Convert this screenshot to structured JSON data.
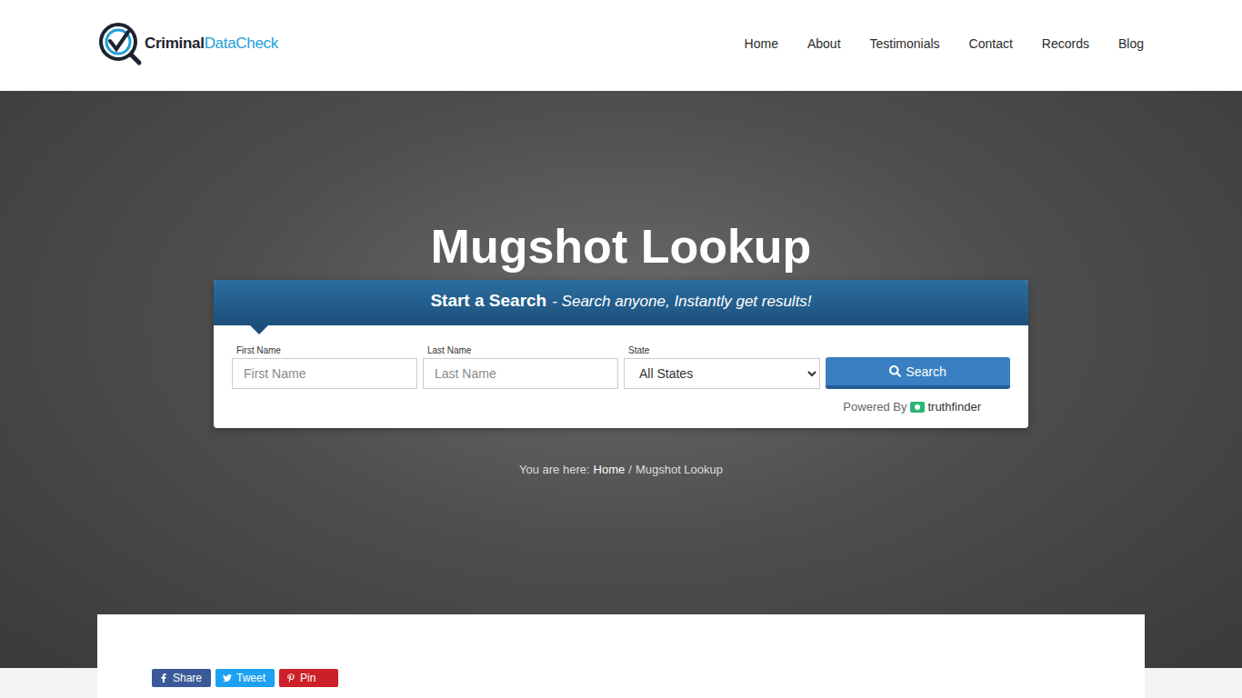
{
  "logo": {
    "brand": "Criminal",
    "suffix": "DataCheck"
  },
  "nav": [
    {
      "label": "Home"
    },
    {
      "label": "About"
    },
    {
      "label": "Testimonials"
    },
    {
      "label": "Contact"
    },
    {
      "label": "Records"
    },
    {
      "label": "Blog"
    }
  ],
  "hero": {
    "title": "Mugshot Lookup"
  },
  "search": {
    "heading": "Start a Search",
    "tagline": "- Search anyone, Instantly get results!",
    "fields": [
      {
        "label": "First Name",
        "placeholder": "First Name",
        "kind": "input"
      },
      {
        "label": "Last Name",
        "placeholder": "Last Name",
        "kind": "input"
      },
      {
        "label": "State",
        "value": "All States",
        "kind": "select"
      }
    ],
    "button": "Search",
    "powered_by": "Powered By",
    "provider": "truthfinder"
  },
  "breadcrumb": {
    "prefix": "You are here:",
    "items": [
      "Home",
      "Mugshot Lookup"
    ],
    "separator": "/"
  },
  "share": [
    {
      "label": "Share",
      "color": "#3b5998"
    },
    {
      "label": "Tweet",
      "color": "#1da1f2"
    },
    {
      "label": "Pin",
      "color": "#cb2027"
    }
  ]
}
